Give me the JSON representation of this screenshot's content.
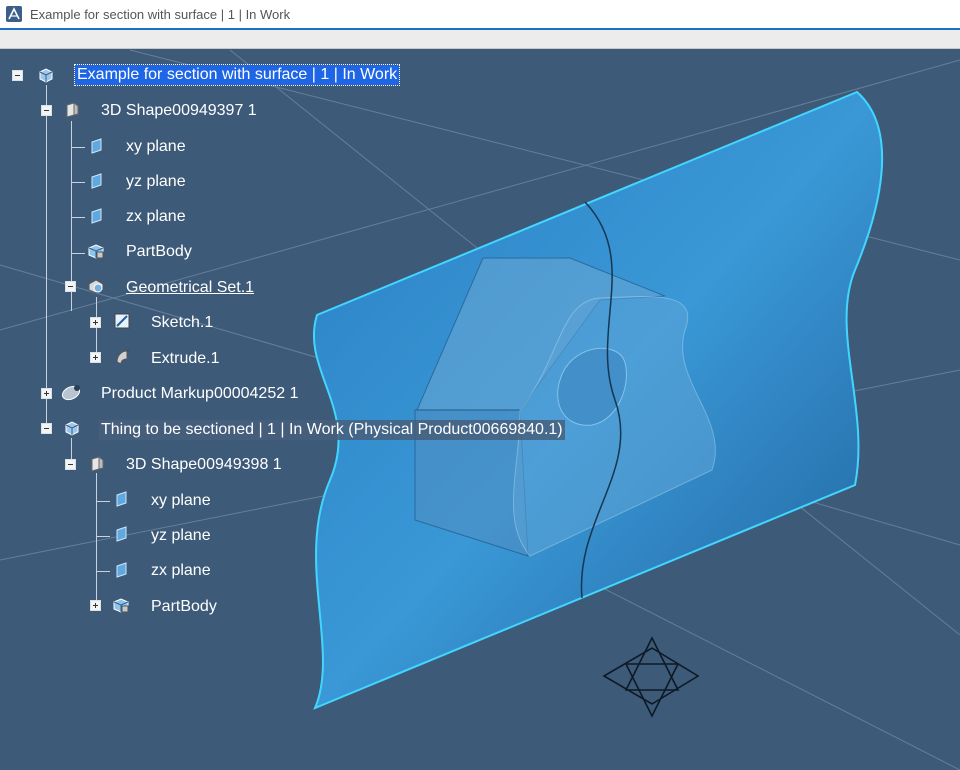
{
  "window": {
    "title": "Example for section with surface | 1 | In Work",
    "app_icon": "catia-icon"
  },
  "colors": {
    "background": "#3d5a78",
    "surface": "#2f86c9",
    "surface_edge": "#3fd2ff",
    "selection": "#1f66e6"
  },
  "tree": {
    "root": {
      "label": "Example for section with surface | 1 | In Work",
      "icon": "product-icon"
    },
    "shape1": {
      "label": "3D Shape00949397 1",
      "icon": "shape-icon"
    },
    "shape1_xy": {
      "label": "xy plane",
      "icon": "plane-icon"
    },
    "shape1_yz": {
      "label": "yz plane",
      "icon": "plane-icon"
    },
    "shape1_zx": {
      "label": "zx plane",
      "icon": "plane-icon"
    },
    "shape1_body": {
      "label": "PartBody",
      "icon": "partbody-icon"
    },
    "geoset": {
      "label": "Geometrical Set.1",
      "icon": "geometrical-set-icon"
    },
    "sketch": {
      "label": "Sketch.1",
      "icon": "sketch-icon"
    },
    "extrude": {
      "label": "Extrude.1",
      "icon": "extrude-icon"
    },
    "markup": {
      "label": "Product Markup00004252 1",
      "icon": "markup-icon"
    },
    "thing": {
      "label": "Thing to be sectioned | 1 | In Work (Physical Product00669840.1)",
      "icon": "product-icon"
    },
    "shape2": {
      "label": "3D Shape00949398 1",
      "icon": "shape-icon"
    },
    "shape2_xy": {
      "label": "xy plane",
      "icon": "plane-icon"
    },
    "shape2_yz": {
      "label": "yz plane",
      "icon": "plane-icon"
    },
    "shape2_zx": {
      "label": "zx plane",
      "icon": "plane-icon"
    },
    "shape2_body": {
      "label": "PartBody",
      "icon": "partbody-icon"
    }
  }
}
